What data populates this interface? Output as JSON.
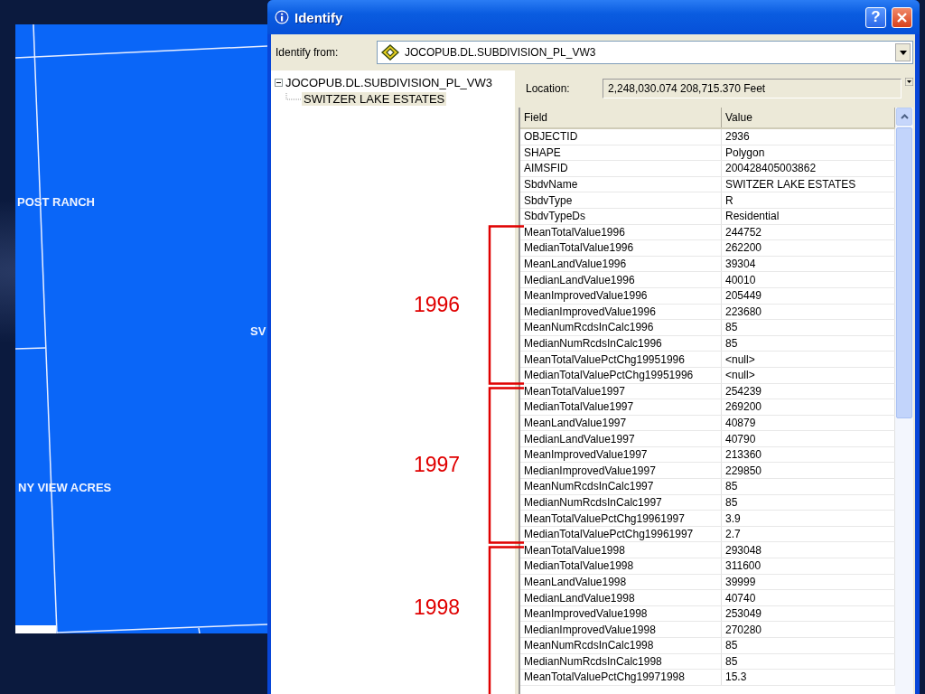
{
  "map": {
    "labels": [
      {
        "text": "POST RANCH"
      },
      {
        "text": "NY VIEW ACRES"
      },
      {
        "text": "SV"
      }
    ]
  },
  "window": {
    "title": "Identify",
    "help_button": "?",
    "identify_from": {
      "label": "Identify from:",
      "value": "JOCOPUB.DL.SUBDIVISION_PL_VW3"
    },
    "tree": {
      "label": "JOCOPUB.DL.SUBDIVISION_PL_VW3",
      "expanded": true,
      "children": [
        {
          "label": "SWITZER LAKE ESTATES",
          "selected": true
        }
      ]
    },
    "location": {
      "label": "Location:",
      "value": "2,248,030.074  208,715.370 Feet"
    },
    "table": {
      "columns": [
        "Field",
        "Value"
      ],
      "rows": [
        [
          "OBJECTID",
          "2936"
        ],
        [
          "SHAPE",
          "Polygon"
        ],
        [
          "AIMSFID",
          "200428405003862"
        ],
        [
          "SbdvName",
          "SWITZER LAKE ESTATES"
        ],
        [
          "SbdvType",
          "R"
        ],
        [
          "SbdvTypeDs",
          "Residential"
        ],
        [
          "MeanTotalValue1996",
          "244752"
        ],
        [
          "MedianTotalValue1996",
          "262200"
        ],
        [
          "MeanLandValue1996",
          "39304"
        ],
        [
          "MedianLandValue1996",
          "40010"
        ],
        [
          "MeanImprovedValue1996",
          "205449"
        ],
        [
          "MedianImprovedValue1996",
          "223680"
        ],
        [
          "MeanNumRcdsInCalc1996",
          "85"
        ],
        [
          "MedianNumRcdsInCalc1996",
          "85"
        ],
        [
          "MeanTotalValuePctChg19951996",
          "<null>"
        ],
        [
          "MedianTotalValuePctChg19951996",
          "<null>"
        ],
        [
          "MeanTotalValue1997",
          "254239"
        ],
        [
          "MedianTotalValue1997",
          "269200"
        ],
        [
          "MeanLandValue1997",
          "40879"
        ],
        [
          "MedianLandValue1997",
          "40790"
        ],
        [
          "MeanImprovedValue1997",
          "213360"
        ],
        [
          "MedianImprovedValue1997",
          "229850"
        ],
        [
          "MeanNumRcdsInCalc1997",
          "85"
        ],
        [
          "MedianNumRcdsInCalc1997",
          "85"
        ],
        [
          "MeanTotalValuePctChg19961997",
          "3.9"
        ],
        [
          "MedianTotalValuePctChg19961997",
          "2.7"
        ],
        [
          "MeanTotalValue1998",
          "293048"
        ],
        [
          "MedianTotalValue1998",
          "311600"
        ],
        [
          "MeanLandValue1998",
          "39999"
        ],
        [
          "MedianLandValue1998",
          "40740"
        ],
        [
          "MeanImprovedValue1998",
          "253049"
        ],
        [
          "MedianImprovedValue1998",
          "270280"
        ],
        [
          "MeanNumRcdsInCalc1998",
          "85"
        ],
        [
          "MedianNumRcdsInCalc1998",
          "85"
        ],
        [
          "MeanTotalValuePctChg19971998",
          "15.3"
        ]
      ]
    }
  },
  "annotations": [
    {
      "label": "1996"
    },
    {
      "label": "1997"
    },
    {
      "label": "1998"
    }
  ]
}
